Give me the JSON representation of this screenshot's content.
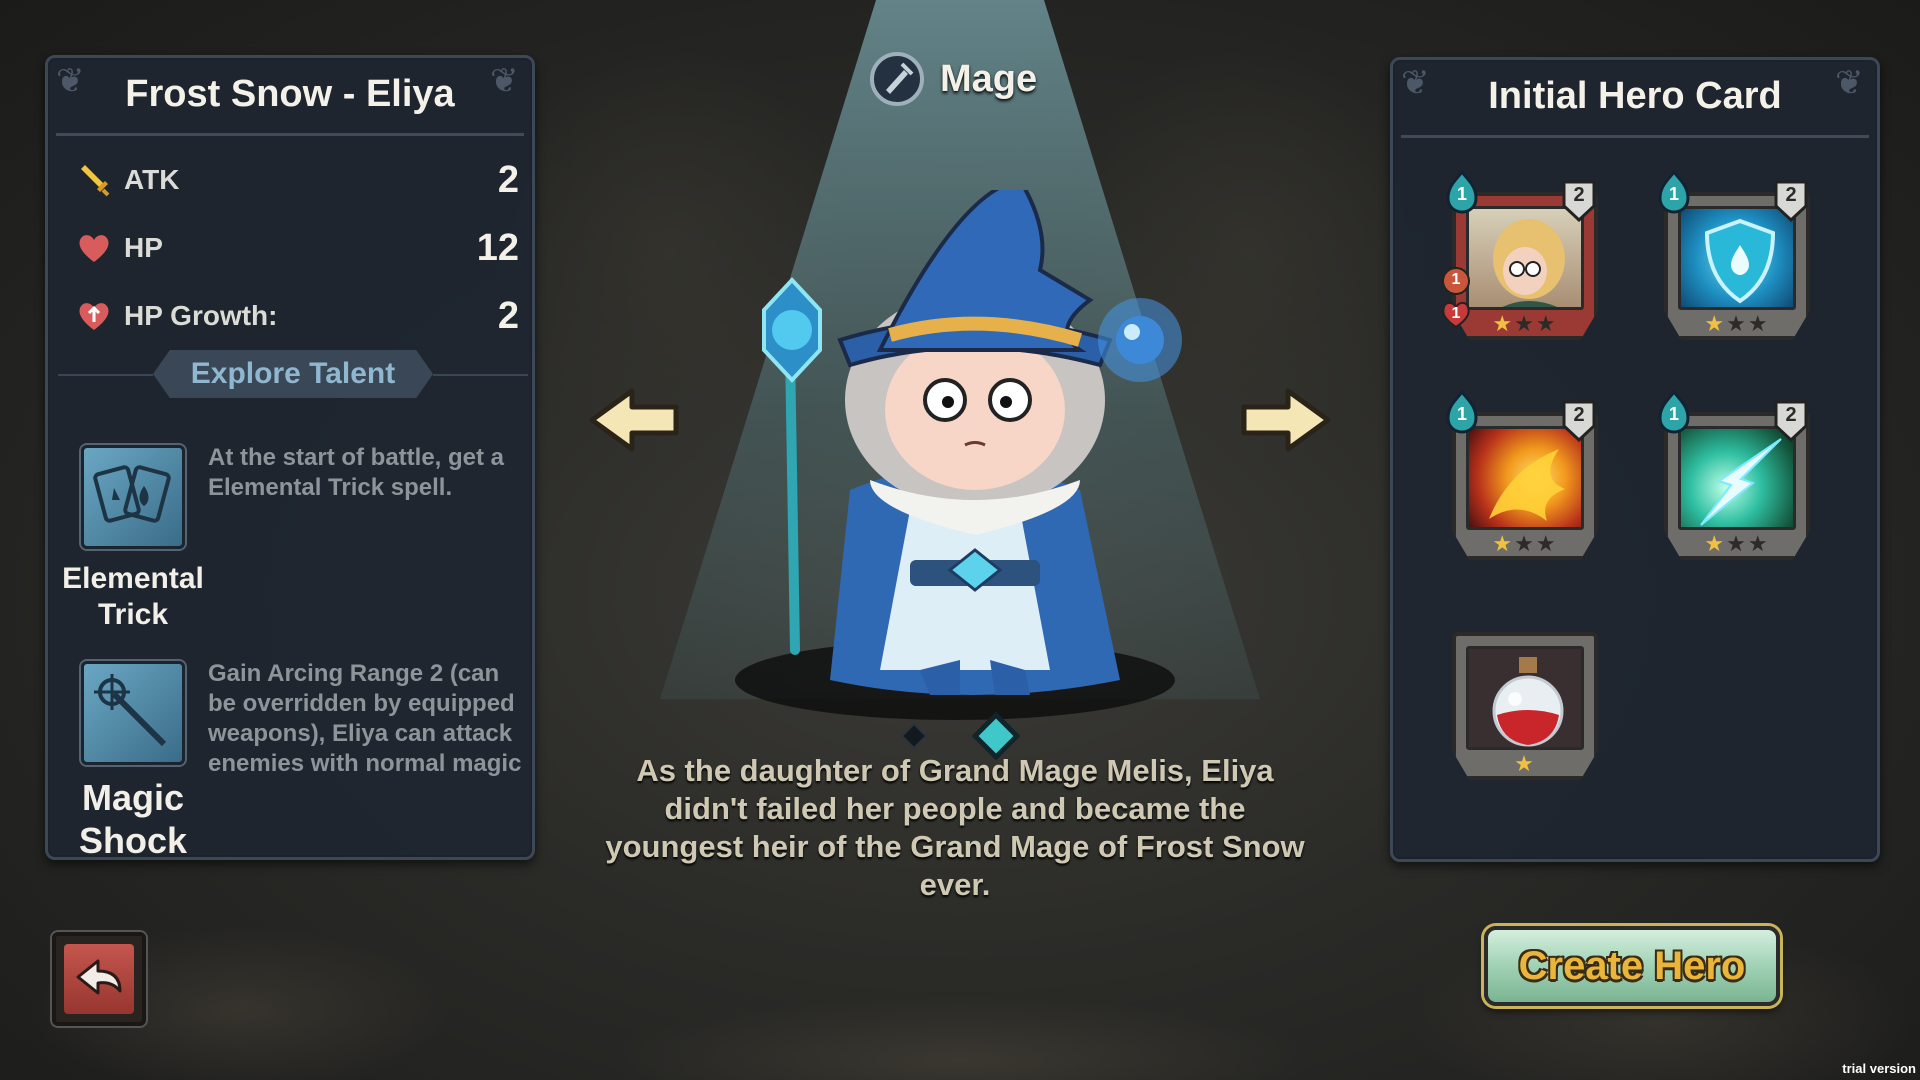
{
  "hero": {
    "name": "Frost Snow - Eliya",
    "class": "Mage",
    "stats": [
      {
        "label": "ATK",
        "value": "2",
        "icon": "sword-icon"
      },
      {
        "label": "HP",
        "value": "12",
        "icon": "heart-icon"
      },
      {
        "label": "HP Growth:",
        "value": "2",
        "icon": "heart-up-icon"
      }
    ],
    "bio": "As the daughter of Grand Mage Melis, Eliya didn't failed her people and became the youngest heir of the Grand Mage of Frost Snow ever."
  },
  "talents": {
    "tab_label": "Explore Talent",
    "items": [
      {
        "name": "Elemental Trick",
        "description": "At the start of battle, get a Elemental Trick spell.",
        "icon": "elemental-cards-icon"
      },
      {
        "name": "Magic Shock",
        "description": "Gain Arcing Range 2 (can be overridden by equipped weapons), Eliya can attack enemies with normal magic",
        "icon": "magic-staff-icon"
      }
    ]
  },
  "cards_panel": {
    "title": "Initial Hero Card",
    "cards": [
      {
        "art": "hero-portrait-card",
        "cost": "1",
        "level": "2",
        "stars": 1,
        "max_stars": 3,
        "frame": "red",
        "attack_badge": "1",
        "hp_badge": "1"
      },
      {
        "art": "shield-card",
        "cost": "1",
        "level": "2",
        "stars": 1,
        "max_stars": 3,
        "frame": "grey"
      },
      {
        "art": "fireball-card",
        "cost": "1",
        "level": "2",
        "stars": 1,
        "max_stars": 3,
        "frame": "grey"
      },
      {
        "art": "lightning-card",
        "cost": "1",
        "level": "2",
        "stars": 1,
        "max_stars": 3,
        "frame": "grey"
      },
      {
        "art": "red-potion-card",
        "stars": 1,
        "max_stars": 1,
        "frame": "grey"
      }
    ]
  },
  "pagination": {
    "pages": 2,
    "current": 2
  },
  "buttons": {
    "create": "Create Hero",
    "back": "back-arrow-icon"
  },
  "watermark": "trial version",
  "colors": {
    "panel": "#1e2630",
    "accent_teal": "#3fc7c9",
    "star": "#f0c040",
    "create_text": "#e9b53a"
  }
}
